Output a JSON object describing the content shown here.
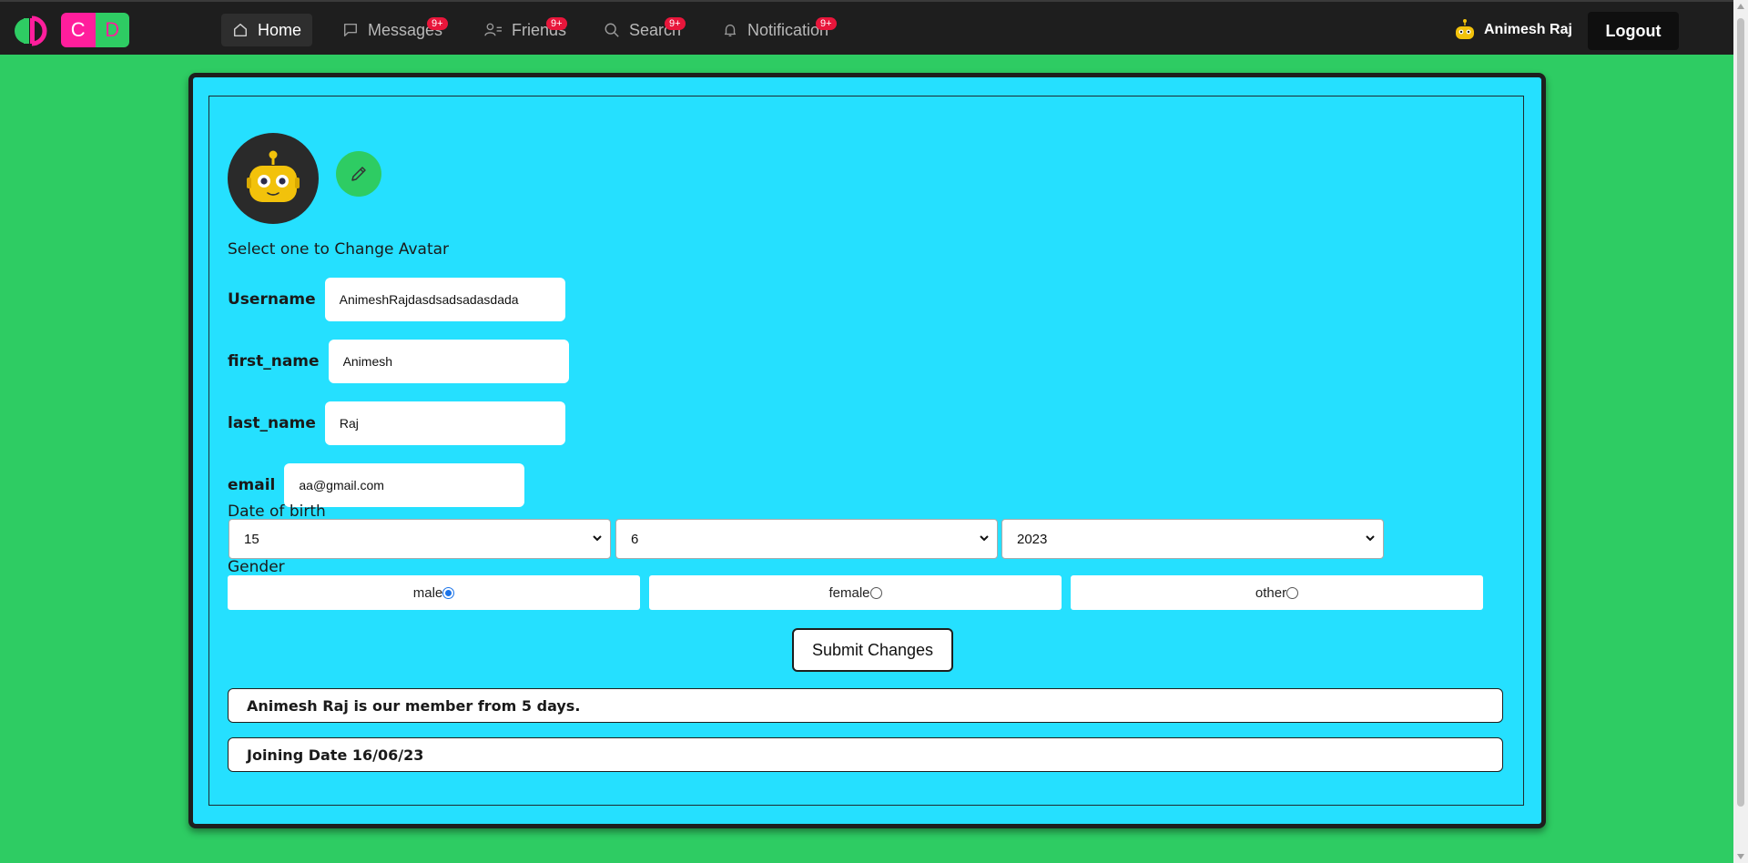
{
  "colors": {
    "page_bg": "#2ecc63",
    "navbar_bg": "#1e1e1e",
    "card_bg": "#25e0ff",
    "logo_pink": "#ff1e9c",
    "badge_red": "#e8163b",
    "radio_blue": "#1a73e8"
  },
  "navbar": {
    "logo_letters": [
      "C",
      "D"
    ],
    "items": [
      {
        "label": "Home",
        "icon": "home-icon",
        "badge": ""
      },
      {
        "label": "Messages",
        "icon": "message-icon",
        "badge": "9+"
      },
      {
        "label": "Friends",
        "icon": "friends-icon",
        "badge": "9+"
      },
      {
        "label": "Search",
        "icon": "search-icon",
        "badge": "9+"
      },
      {
        "label": "Notification",
        "icon": "bell-icon",
        "badge": "9+"
      }
    ],
    "user_name": "Animesh Raj",
    "logout_label": "Logout"
  },
  "profile": {
    "avatar_hint": "Select one to Change Avatar",
    "fields": {
      "username": {
        "label": "Username",
        "value": "AnimeshRajdasdsadsadasdada"
      },
      "first_name": {
        "label": "first_name",
        "value": "Animesh"
      },
      "last_name": {
        "label": "last_name",
        "value": "Raj"
      },
      "email": {
        "label": "email",
        "value": "aa@gmail.com"
      }
    },
    "dob": {
      "label": "Date of birth",
      "day": "15",
      "month": "6",
      "year": "2023"
    },
    "gender": {
      "label": "Gender",
      "options": [
        "male",
        "female",
        "other"
      ],
      "selected": "male"
    },
    "submit_label": "Submit Changes",
    "member_text": "Animesh Raj is our member from 5 days.",
    "joining_text": "Joining Date 16/06/23"
  }
}
